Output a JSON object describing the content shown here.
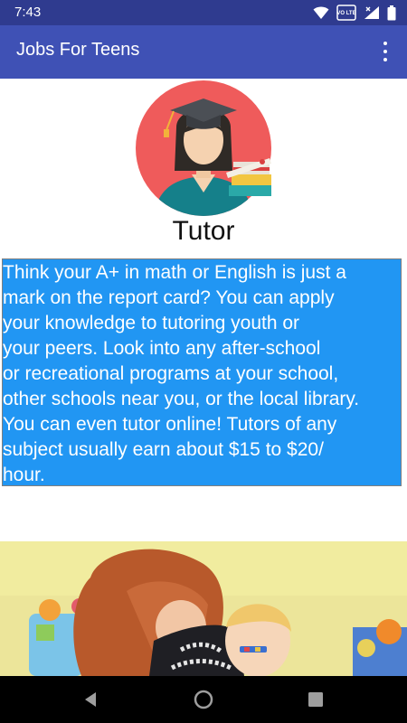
{
  "status_bar": {
    "time": "7:43",
    "icons": [
      "wifi-icon",
      "volte-icon",
      "cell-signal-icon",
      "battery-icon"
    ],
    "volte_label": "VO LTE"
  },
  "app_bar": {
    "title": "Jobs For Teens",
    "menu_icon": "overflow-menu-icon"
  },
  "job": {
    "title": "Tutor",
    "description": "Think your A+ in math or English is just a\nmark on the report card? You can apply\nyour knowledge to tutoring youth or\nyour peers. Look into any after-school\nor recreational programs at your school,\nother schools near you, or the local library.\nYou can even tutor online! Tutors of any\nsubject usually earn about $15 to $20/\nhour.",
    "colors": {
      "description_bg": "#2196f3",
      "avatar_bg": "#ef5b5b",
      "app_bar": "#3f51b5"
    }
  },
  "nav_bar": {
    "buttons": [
      "back-icon",
      "home-icon",
      "recents-icon"
    ]
  }
}
